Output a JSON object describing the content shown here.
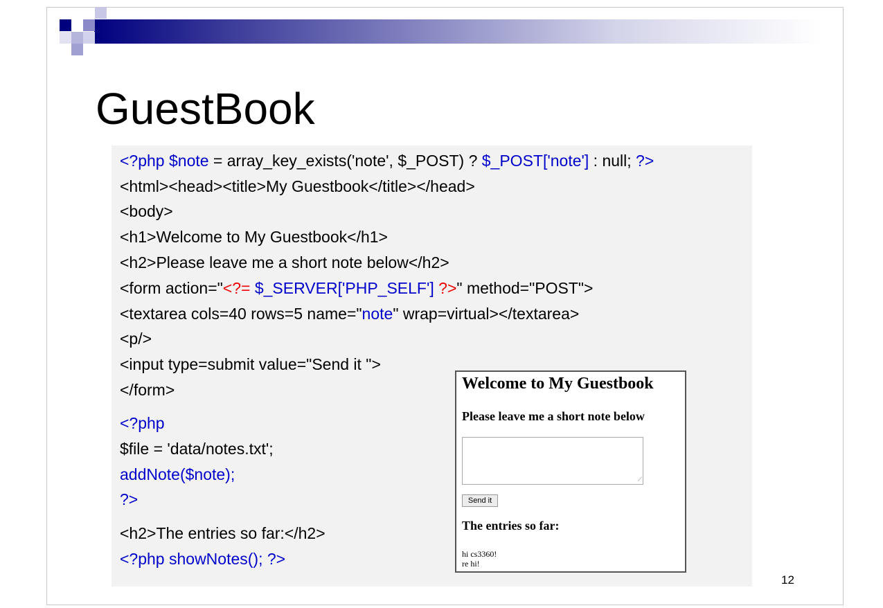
{
  "slide": {
    "title": "GuestBook",
    "page_number": "12"
  },
  "code": {
    "line1": {
      "a": "<?php $note",
      "b": " = array_key_exists('note', $_POST) ? ",
      "c": "$_POST['note']",
      "d": " : null; ",
      "e": "?>"
    },
    "line2": "<html><head><title>My Guestbook</title></head>",
    "line3": "<body>",
    "line4": "<h1>Welcome to My Guestbook</h1>",
    "line5": "<h2>Please leave me a short note below</h2>",
    "line6": {
      "a": "<form action=\"",
      "b": "<?=",
      "c": " $_SERVER['PHP_SELF']",
      "d": " ?>",
      "e": "\" method=\"POST\">"
    },
    "line7": {
      "a": "<textarea cols=40 rows=5 name=\"",
      "b": "note",
      "c": "\" wrap=virtual></textarea>"
    },
    "line8": "<p/>",
    "line9": "<input type=submit value=\"Send it \">",
    "line10": "</form>",
    "line11": "<?php",
    "line12": "$file = 'data/notes.txt';",
    "line13": "addNote($note);",
    "line14": "?>",
    "line15": "<h2>The entries so far:</h2>",
    "line16": "<?php showNotes(); ?>"
  },
  "preview": {
    "heading": "Welcome to My Guestbook",
    "subheading": "Please leave me a short note below",
    "textarea_value": "",
    "submit_label": "Send it",
    "entries_heading": "The entries so far:",
    "entries": [
      "hi cs3360!",
      "re hi!"
    ]
  }
}
